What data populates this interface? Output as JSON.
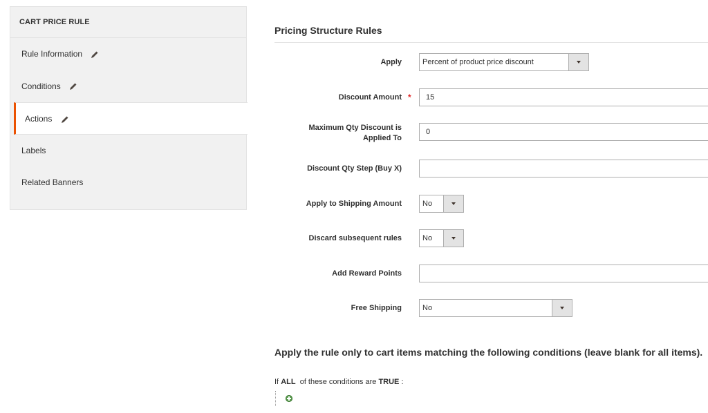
{
  "sidebar": {
    "title": "CART PRICE RULE",
    "items": [
      {
        "label": "Rule Information",
        "edit_icon": "pencil-icon"
      },
      {
        "label": "Conditions",
        "edit_icon": "pencil-icon"
      },
      {
        "label": "Actions",
        "edit_icon": "pencil-icon",
        "active": true
      },
      {
        "label": "Labels"
      },
      {
        "label": "Related Banners"
      }
    ]
  },
  "pricing": {
    "title": "Pricing Structure Rules",
    "apply": {
      "label": "Apply",
      "value": "Percent of product price discount"
    },
    "discount_amount": {
      "label": "Discount Amount",
      "value": "15",
      "required_mark": "*"
    },
    "max_qty": {
      "label_line1": "Maximum Qty Discount is",
      "label_line2": "Applied To",
      "value": "0"
    },
    "qty_step": {
      "label": "Discount Qty Step (Buy X)",
      "value": ""
    },
    "apply_shipping": {
      "label": "Apply to Shipping Amount",
      "value": "No"
    },
    "discard_rules": {
      "label": "Discard subsequent rules",
      "value": "No"
    },
    "reward_points": {
      "label": "Add Reward Points",
      "value": ""
    },
    "free_shipping": {
      "label": "Free Shipping",
      "value": "No"
    }
  },
  "conditions": {
    "title": "Apply the rule only to cart items matching the following conditions (leave blank for all items).",
    "prefix": "If",
    "aggregator": "ALL",
    "middle": "of these conditions are",
    "value": "TRUE",
    "suffix": ":",
    "add_icon": "add-condition-icon"
  },
  "colors": {
    "accent": "#eb5202",
    "required": "#e22626",
    "add": "#5f9e53"
  }
}
